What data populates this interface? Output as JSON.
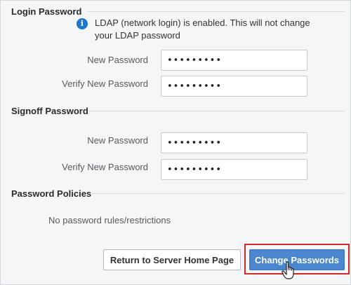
{
  "login_section": {
    "title": "Login Password",
    "info_icon": "info-circle-icon",
    "info_message": "LDAP (network login) is enabled. This will not change your LDAP password",
    "new_password_label": "New Password",
    "new_password_value": "•••••••••",
    "verify_password_label": "Verify New Password",
    "verify_password_value": "•••••••••"
  },
  "signoff_section": {
    "title": "Signoff Password",
    "new_password_label": "New Password",
    "new_password_value": "•••••••••",
    "verify_password_label": "Verify New Password",
    "verify_password_value": "•••••••••"
  },
  "policies_section": {
    "title": "Password Policies",
    "message": "No password rules/restrictions"
  },
  "actions": {
    "return_home_label": "Return to Server Home Page",
    "change_passwords_label": "Change Passwords"
  },
  "colors": {
    "primary_button": "#4b86cf",
    "highlight_border": "#d6282b",
    "info_icon": "#1d76cf"
  }
}
